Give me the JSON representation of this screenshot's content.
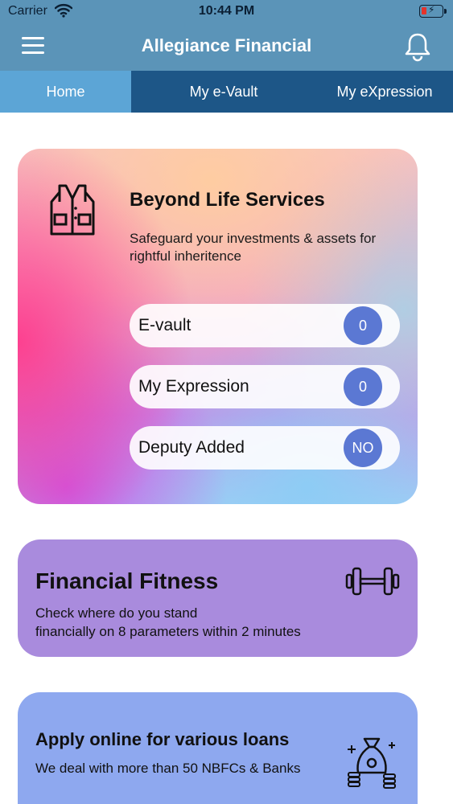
{
  "status_bar": {
    "carrier": "Carrier",
    "time": "10:44 PM"
  },
  "header": {
    "title": "Allegiance Financial"
  },
  "tabs": [
    {
      "label": "Home",
      "active": true
    },
    {
      "label": "My e-Vault",
      "active": false
    },
    {
      "label": "My eXpression",
      "active": false
    }
  ],
  "beyond_life": {
    "title": "Beyond Life Services",
    "description": "Safeguard your investments & assets for rightful inheritence",
    "items": [
      {
        "label": "E-vault",
        "value": "0"
      },
      {
        "label": "My Expression",
        "value": "0"
      },
      {
        "label": "Deputy Added",
        "value": "NO"
      }
    ]
  },
  "financial_fitness": {
    "title": "Financial Fitness",
    "description_line1": "Check where do you stand",
    "description_line2": "financially on 8 parameters within 2 minutes"
  },
  "loans": {
    "title": "Apply online for various loans",
    "description": "We deal with more than 50 NBFCs & Banks"
  },
  "colors": {
    "header": "#5b94b8",
    "tab_bar": "#1d5687",
    "tab_active": "#5ca5d6",
    "badge": "#5b78d3",
    "fitness_card": "#a98bdd",
    "loans_card": "#8ea8ef"
  },
  "icons": [
    "wifi-icon",
    "battery-icon",
    "menu-icon",
    "bell-icon",
    "vest-icon",
    "dumbbell-icon",
    "money-bag-icon"
  ]
}
